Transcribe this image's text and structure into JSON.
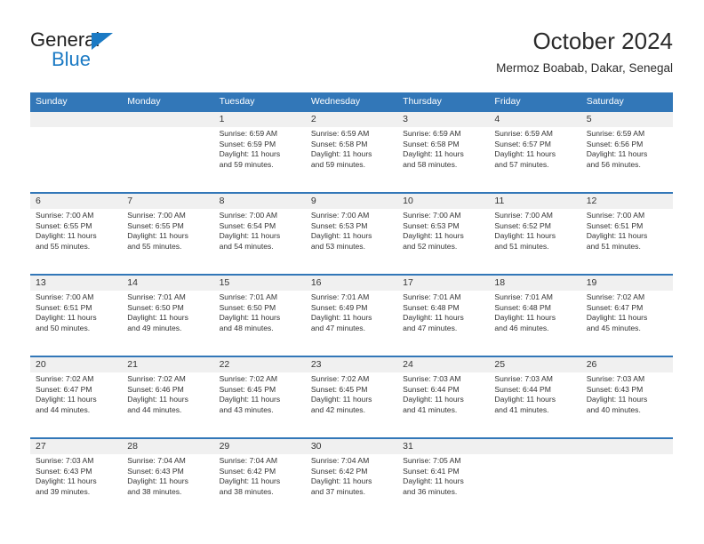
{
  "logo": {
    "word_one": "General",
    "word_two": "Blue",
    "triangle_icon": "blue-triangle-icon",
    "accent_color": "#1b7ac4"
  },
  "header": {
    "title": "October 2024",
    "subtitle": "Mermoz Boabab, Dakar, Senegal"
  },
  "theme": {
    "header_blue": "#3277b8",
    "daynum_band": "#f0f0f0",
    "text": "#333333"
  },
  "weekdays": [
    "Sunday",
    "Monday",
    "Tuesday",
    "Wednesday",
    "Thursday",
    "Friday",
    "Saturday"
  ],
  "weeks": [
    {
      "days": [
        {
          "num": "",
          "sunrise": "",
          "sunset": "",
          "daylight_line1": "",
          "daylight_line2": ""
        },
        {
          "num": "",
          "sunrise": "",
          "sunset": "",
          "daylight_line1": "",
          "daylight_line2": ""
        },
        {
          "num": "1",
          "sunrise": "Sunrise: 6:59 AM",
          "sunset": "Sunset: 6:59 PM",
          "daylight_line1": "Daylight: 11 hours",
          "daylight_line2": "and 59 minutes."
        },
        {
          "num": "2",
          "sunrise": "Sunrise: 6:59 AM",
          "sunset": "Sunset: 6:58 PM",
          "daylight_line1": "Daylight: 11 hours",
          "daylight_line2": "and 59 minutes."
        },
        {
          "num": "3",
          "sunrise": "Sunrise: 6:59 AM",
          "sunset": "Sunset: 6:58 PM",
          "daylight_line1": "Daylight: 11 hours",
          "daylight_line2": "and 58 minutes."
        },
        {
          "num": "4",
          "sunrise": "Sunrise: 6:59 AM",
          "sunset": "Sunset: 6:57 PM",
          "daylight_line1": "Daylight: 11 hours",
          "daylight_line2": "and 57 minutes."
        },
        {
          "num": "5",
          "sunrise": "Sunrise: 6:59 AM",
          "sunset": "Sunset: 6:56 PM",
          "daylight_line1": "Daylight: 11 hours",
          "daylight_line2": "and 56 minutes."
        }
      ]
    },
    {
      "days": [
        {
          "num": "6",
          "sunrise": "Sunrise: 7:00 AM",
          "sunset": "Sunset: 6:55 PM",
          "daylight_line1": "Daylight: 11 hours",
          "daylight_line2": "and 55 minutes."
        },
        {
          "num": "7",
          "sunrise": "Sunrise: 7:00 AM",
          "sunset": "Sunset: 6:55 PM",
          "daylight_line1": "Daylight: 11 hours",
          "daylight_line2": "and 55 minutes."
        },
        {
          "num": "8",
          "sunrise": "Sunrise: 7:00 AM",
          "sunset": "Sunset: 6:54 PM",
          "daylight_line1": "Daylight: 11 hours",
          "daylight_line2": "and 54 minutes."
        },
        {
          "num": "9",
          "sunrise": "Sunrise: 7:00 AM",
          "sunset": "Sunset: 6:53 PM",
          "daylight_line1": "Daylight: 11 hours",
          "daylight_line2": "and 53 minutes."
        },
        {
          "num": "10",
          "sunrise": "Sunrise: 7:00 AM",
          "sunset": "Sunset: 6:53 PM",
          "daylight_line1": "Daylight: 11 hours",
          "daylight_line2": "and 52 minutes."
        },
        {
          "num": "11",
          "sunrise": "Sunrise: 7:00 AM",
          "sunset": "Sunset: 6:52 PM",
          "daylight_line1": "Daylight: 11 hours",
          "daylight_line2": "and 51 minutes."
        },
        {
          "num": "12",
          "sunrise": "Sunrise: 7:00 AM",
          "sunset": "Sunset: 6:51 PM",
          "daylight_line1": "Daylight: 11 hours",
          "daylight_line2": "and 51 minutes."
        }
      ]
    },
    {
      "days": [
        {
          "num": "13",
          "sunrise": "Sunrise: 7:00 AM",
          "sunset": "Sunset: 6:51 PM",
          "daylight_line1": "Daylight: 11 hours",
          "daylight_line2": "and 50 minutes."
        },
        {
          "num": "14",
          "sunrise": "Sunrise: 7:01 AM",
          "sunset": "Sunset: 6:50 PM",
          "daylight_line1": "Daylight: 11 hours",
          "daylight_line2": "and 49 minutes."
        },
        {
          "num": "15",
          "sunrise": "Sunrise: 7:01 AM",
          "sunset": "Sunset: 6:50 PM",
          "daylight_line1": "Daylight: 11 hours",
          "daylight_line2": "and 48 minutes."
        },
        {
          "num": "16",
          "sunrise": "Sunrise: 7:01 AM",
          "sunset": "Sunset: 6:49 PM",
          "daylight_line1": "Daylight: 11 hours",
          "daylight_line2": "and 47 minutes."
        },
        {
          "num": "17",
          "sunrise": "Sunrise: 7:01 AM",
          "sunset": "Sunset: 6:48 PM",
          "daylight_line1": "Daylight: 11 hours",
          "daylight_line2": "and 47 minutes."
        },
        {
          "num": "18",
          "sunrise": "Sunrise: 7:01 AM",
          "sunset": "Sunset: 6:48 PM",
          "daylight_line1": "Daylight: 11 hours",
          "daylight_line2": "and 46 minutes."
        },
        {
          "num": "19",
          "sunrise": "Sunrise: 7:02 AM",
          "sunset": "Sunset: 6:47 PM",
          "daylight_line1": "Daylight: 11 hours",
          "daylight_line2": "and 45 minutes."
        }
      ]
    },
    {
      "days": [
        {
          "num": "20",
          "sunrise": "Sunrise: 7:02 AM",
          "sunset": "Sunset: 6:47 PM",
          "daylight_line1": "Daylight: 11 hours",
          "daylight_line2": "and 44 minutes."
        },
        {
          "num": "21",
          "sunrise": "Sunrise: 7:02 AM",
          "sunset": "Sunset: 6:46 PM",
          "daylight_line1": "Daylight: 11 hours",
          "daylight_line2": "and 44 minutes."
        },
        {
          "num": "22",
          "sunrise": "Sunrise: 7:02 AM",
          "sunset": "Sunset: 6:45 PM",
          "daylight_line1": "Daylight: 11 hours",
          "daylight_line2": "and 43 minutes."
        },
        {
          "num": "23",
          "sunrise": "Sunrise: 7:02 AM",
          "sunset": "Sunset: 6:45 PM",
          "daylight_line1": "Daylight: 11 hours",
          "daylight_line2": "and 42 minutes."
        },
        {
          "num": "24",
          "sunrise": "Sunrise: 7:03 AM",
          "sunset": "Sunset: 6:44 PM",
          "daylight_line1": "Daylight: 11 hours",
          "daylight_line2": "and 41 minutes."
        },
        {
          "num": "25",
          "sunrise": "Sunrise: 7:03 AM",
          "sunset": "Sunset: 6:44 PM",
          "daylight_line1": "Daylight: 11 hours",
          "daylight_line2": "and 41 minutes."
        },
        {
          "num": "26",
          "sunrise": "Sunrise: 7:03 AM",
          "sunset": "Sunset: 6:43 PM",
          "daylight_line1": "Daylight: 11 hours",
          "daylight_line2": "and 40 minutes."
        }
      ]
    },
    {
      "days": [
        {
          "num": "27",
          "sunrise": "Sunrise: 7:03 AM",
          "sunset": "Sunset: 6:43 PM",
          "daylight_line1": "Daylight: 11 hours",
          "daylight_line2": "and 39 minutes."
        },
        {
          "num": "28",
          "sunrise": "Sunrise: 7:04 AM",
          "sunset": "Sunset: 6:43 PM",
          "daylight_line1": "Daylight: 11 hours",
          "daylight_line2": "and 38 minutes."
        },
        {
          "num": "29",
          "sunrise": "Sunrise: 7:04 AM",
          "sunset": "Sunset: 6:42 PM",
          "daylight_line1": "Daylight: 11 hours",
          "daylight_line2": "and 38 minutes."
        },
        {
          "num": "30",
          "sunrise": "Sunrise: 7:04 AM",
          "sunset": "Sunset: 6:42 PM",
          "daylight_line1": "Daylight: 11 hours",
          "daylight_line2": "and 37 minutes."
        },
        {
          "num": "31",
          "sunrise": "Sunrise: 7:05 AM",
          "sunset": "Sunset: 6:41 PM",
          "daylight_line1": "Daylight: 11 hours",
          "daylight_line2": "and 36 minutes."
        },
        {
          "num": "",
          "sunrise": "",
          "sunset": "",
          "daylight_line1": "",
          "daylight_line2": ""
        },
        {
          "num": "",
          "sunrise": "",
          "sunset": "",
          "daylight_line1": "",
          "daylight_line2": ""
        }
      ]
    }
  ]
}
